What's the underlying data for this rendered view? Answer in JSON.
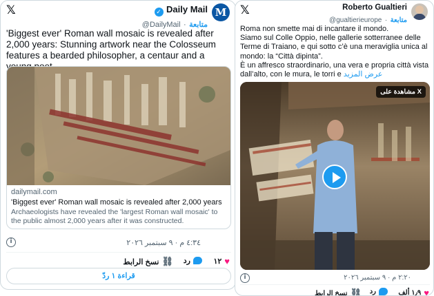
{
  "left_tweet": {
    "author_name": "Daily Mail",
    "author_handle": "@DailyMail",
    "follow_label": "متابعة",
    "text": "'Biggest ever' Roman wall mosaic is revealed after 2,000 years: Stunning artwork near the Colosseum features a bearded philosopher, a centaur and a young poet",
    "link_card": {
      "domain": "dailymail.com",
      "title": "'Biggest ever' Roman wall mosaic is revealed after 2,000 years",
      "description": "Archaeologists have revealed the 'largest Roman wall mosaic' to the public almost 2,000 years after it was constructed."
    },
    "timestamp": "٤:٣٤ م · ٩ سبتمبر ٢٠٢٦",
    "likes": "١٢",
    "reply_label": "رد",
    "copy_link_label": "نسخ الرابط",
    "read_replies_label": "قراءة ١ ردّ"
  },
  "right_tweet": {
    "author_name": "Roberto Gualtieri",
    "author_handle": "@gualtierieurope",
    "follow_label": "متابعة",
    "text_lines": [
      "Roma non smette mai di incantare il mondo.",
      "Siamo sul Colle Oppio, nelle gallerie sotterranee delle",
      "Terme di Traiano, e qui sotto c’è una meraviglia unica al",
      "mondo: la “Città dipinta”.",
      "È un affresco straordinario, una vera e propria città vista",
      "dall’alto, con le mura, le torri e"
    ],
    "show_more_label": "عرض المزيد",
    "video_badge": "مشاهدة على X",
    "timestamp": "٢:٢٠ م · ٩ سبتمبر ٢٠٢٦",
    "likes": "١٫٩ ألف",
    "reply_label": "رد",
    "copy_link_label": "نسخ الرابط"
  },
  "colors": {
    "accent": "#1d9bf0",
    "heart": "#f91880",
    "secondary_text": "#536471",
    "border": "#cfd9de"
  },
  "icons": [
    "x-logo-icon",
    "info-icon",
    "verified-badge-icon",
    "heart-icon",
    "reply-icon",
    "link-icon",
    "play-icon",
    "daily-mail-logo-icon",
    "avatar"
  ]
}
